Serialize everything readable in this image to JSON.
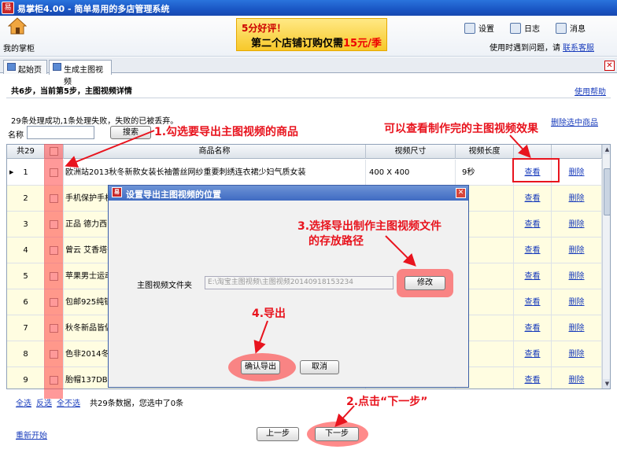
{
  "app": {
    "title": "易掌柜4.00 - 简单易用的多店管理系统",
    "logo_text": "易"
  },
  "header": {
    "home_label": "我的掌柜",
    "banner_line1": "5分好评！",
    "banner_line2": "第二个店铺订购仅需",
    "banner_price": "15元/季",
    "tools": [
      "设置",
      "日志",
      "消息"
    ],
    "help_text": "使用时遇到问题，请",
    "help_link": "联系客服"
  },
  "tabs": [
    {
      "label": "起始页"
    },
    {
      "label": "生成主图视频"
    }
  ],
  "page": {
    "step_title": "共6步，当前第5步，主图视频详情",
    "use_help": "使用帮助",
    "status": "29条处理成功,1条处理失败，失败的已被丢弃。",
    "name_label": "名称",
    "search_label": "搜索",
    "delete_selected": "删除选中商品"
  },
  "grid": {
    "total": "共29",
    "columns": [
      "商品名称",
      "视频尺寸",
      "视频长度"
    ],
    "view_label": "查看",
    "delete_label": "删除",
    "rows": [
      {
        "no": "1",
        "name": "欧洲站2013秋冬新款女装长袖蕾丝网纱重要刺绣连衣裙少妇气质女装",
        "size": "400 X 400",
        "length": "9秒"
      },
      {
        "no": "2",
        "name": "手机保护手机"
      },
      {
        "no": "3",
        "name": "正品 德力西"
      },
      {
        "no": "4",
        "name": "曾云 艾香塔香"
      },
      {
        "no": "5",
        "name": "苹果男士运动"
      },
      {
        "no": "6",
        "name": "包邮925纯银"
      },
      {
        "no": "7",
        "name": "秋冬新品皆侣"
      },
      {
        "no": "8",
        "name": "色非2014冬季"
      },
      {
        "no": "9",
        "name": "胎帽137DB"
      }
    ]
  },
  "footer": {
    "select_all": "全选",
    "select_inverse": "反选",
    "select_none": "全不选",
    "count_text": "共29条数据，您选中了0条",
    "restart": "重新开始",
    "prev": "上一步",
    "next": "下一步"
  },
  "dialog": {
    "title": "设置导出主图视频的位置",
    "label": "主图视频文件夹",
    "path": "E:\\淘宝主图视频\\主图视频20140918153234",
    "modify": "修改",
    "confirm": "确认导出",
    "cancel": "取消"
  },
  "annotations": {
    "a1": "1.勾选要导出主图视频的商品",
    "a_view": "可以查看制作完的主图视频效果",
    "a3_line1": "3.选择导出制作主图视频文件",
    "a3_line2": "的存放路径",
    "a4": "4.导出",
    "a2": "2.点击“下一步”"
  },
  "colors": {
    "annotation": "#e8141e",
    "titlebar": "#1a56c4",
    "link": "#1a3dbc",
    "row_highlight": "#fffde1"
  }
}
